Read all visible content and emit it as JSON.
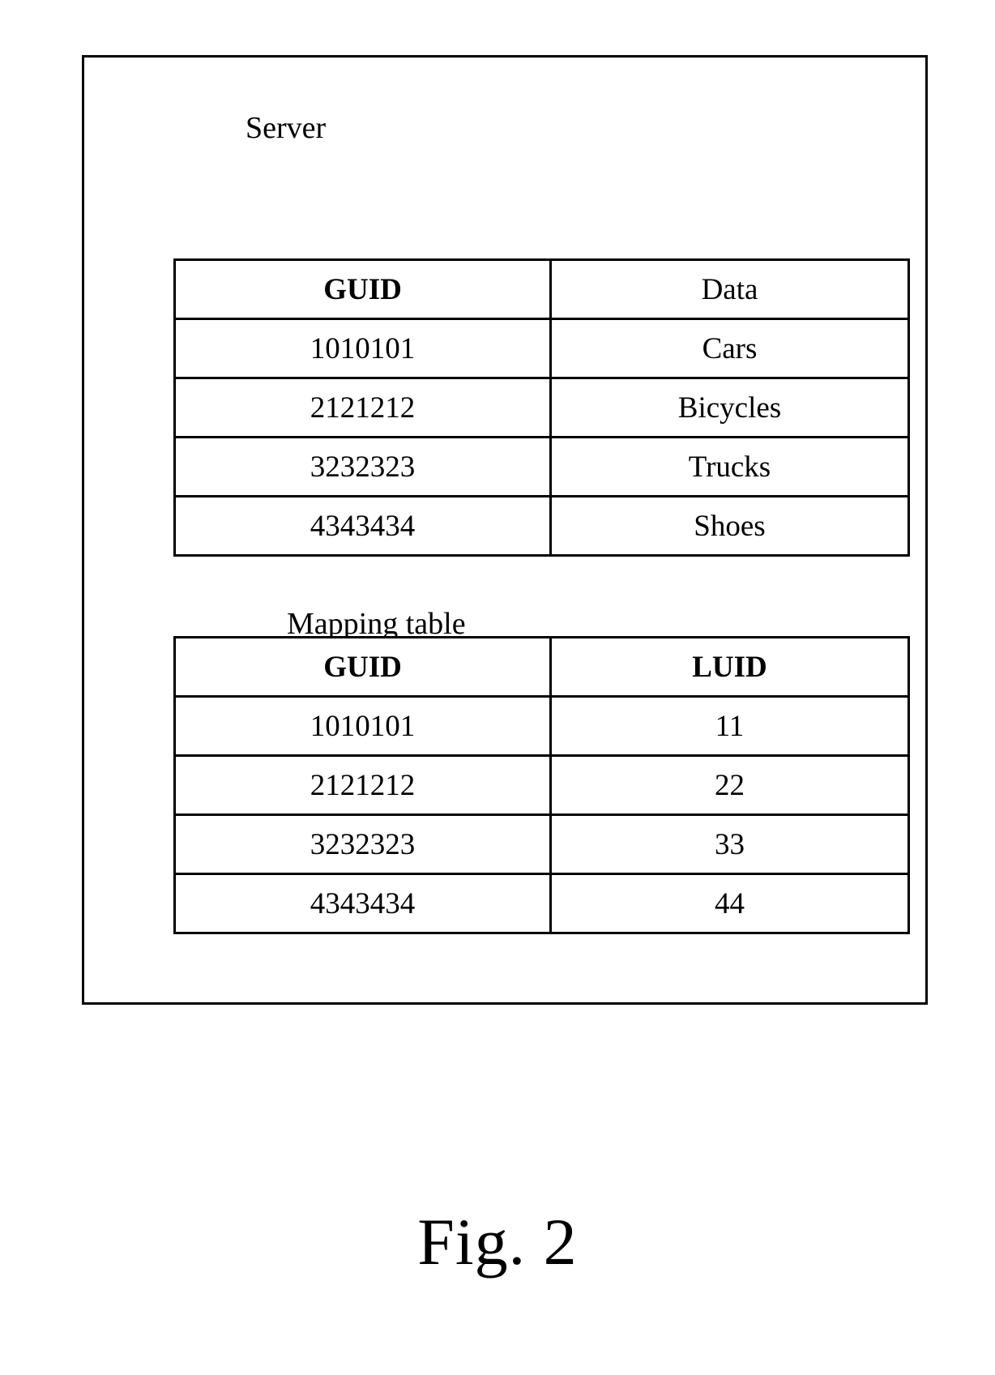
{
  "figure": {
    "caption": "Fig. 2",
    "server_label": "Server",
    "mapping_label": "Mapping table"
  },
  "server_table": {
    "headers": [
      "GUID",
      "Data"
    ],
    "rows": [
      [
        "1010101",
        "Cars"
      ],
      [
        "2121212",
        "Bicycles"
      ],
      [
        "3232323",
        "Trucks"
      ],
      [
        "4343434",
        "Shoes"
      ]
    ]
  },
  "mapping_table": {
    "headers": [
      "GUID",
      "LUID"
    ],
    "rows": [
      [
        "1010101",
        "11"
      ],
      [
        "2121212",
        "22"
      ],
      [
        "3232323",
        "33"
      ],
      [
        "4343434",
        "44"
      ]
    ]
  },
  "colors": {
    "ink": "#000000",
    "paper": "#ffffff"
  }
}
